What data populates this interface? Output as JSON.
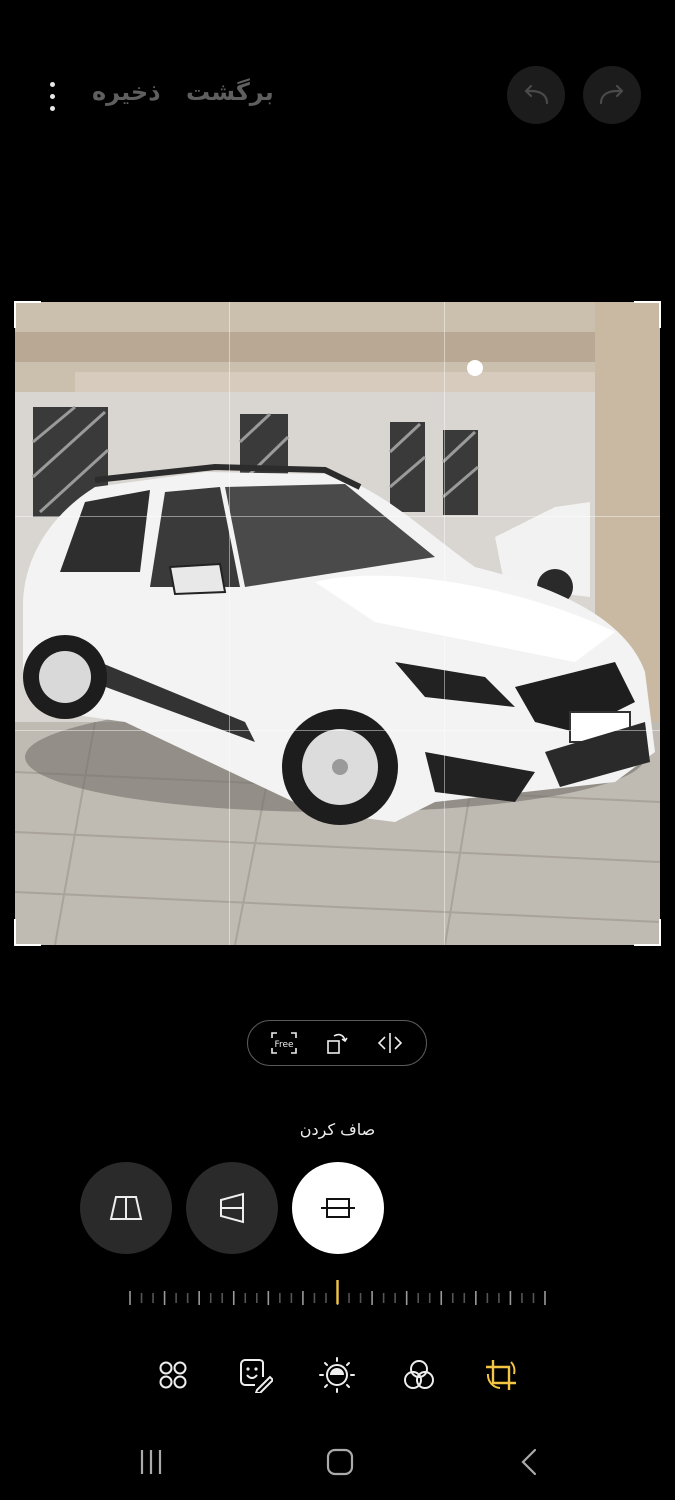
{
  "toolbar": {
    "back_label": "برگشت",
    "save_label": "ذخیره",
    "more_icon": "more-vert-icon",
    "undo_icon": "undo-icon",
    "redo_icon": "redo-icon"
  },
  "crop_tools": {
    "free_label": "Free",
    "rotate_icon": "rotate-icon",
    "flip_icon": "flip-icon"
  },
  "transform": {
    "mode_label": "صاف کردن",
    "modes": [
      {
        "name": "vertical-perspective",
        "icon": "perspective-vertical-icon",
        "active": false
      },
      {
        "name": "horizontal-perspective",
        "icon": "perspective-horizontal-icon",
        "active": false
      },
      {
        "name": "straighten",
        "icon": "straighten-icon",
        "active": true
      }
    ],
    "slider_value_percent": 50
  },
  "bottom_tools": [
    {
      "name": "effects",
      "icon": "four-circles-icon"
    },
    {
      "name": "stickers",
      "icon": "sticker-pen-icon"
    },
    {
      "name": "adjust",
      "icon": "brightness-icon"
    },
    {
      "name": "filters",
      "icon": "filters-icon"
    },
    {
      "name": "crop",
      "icon": "crop-rotate-icon",
      "active": true
    }
  ],
  "colors": {
    "accent": "#f4c542",
    "background": "#000000"
  }
}
